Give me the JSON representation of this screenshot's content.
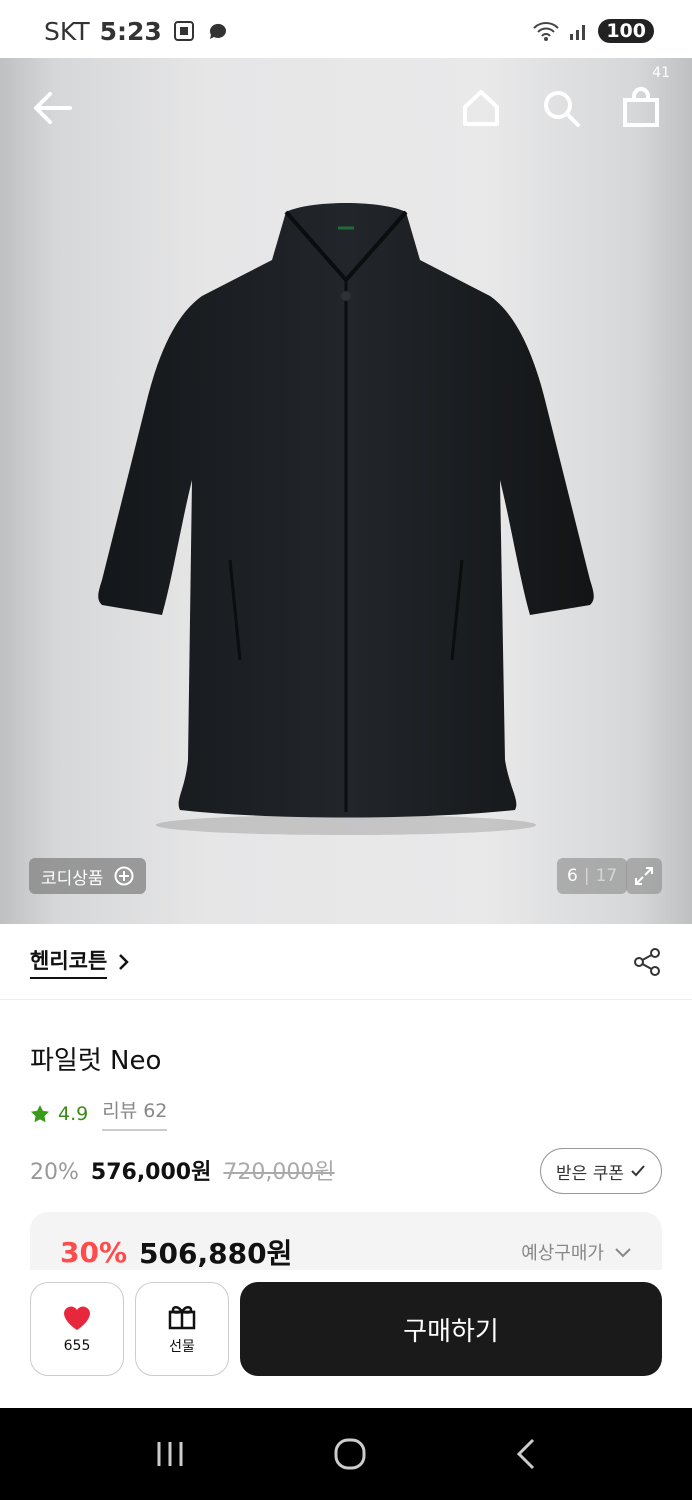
{
  "status_bar": {
    "carrier": "SKT",
    "time": "5:23",
    "battery": "100"
  },
  "header": {
    "cart_count": "41"
  },
  "gallery": {
    "codi_label": "코디상품",
    "current": "6",
    "separator": "|",
    "total": "17"
  },
  "brand": {
    "name": "헨리코튼"
  },
  "product": {
    "title": "파일럿 Neo",
    "rating": "4.9",
    "review_label": "리뷰 62",
    "discount": "20%",
    "price": "576,000원",
    "original_price": "720,000원",
    "coupon_label": "받은 쿠폰"
  },
  "estimate": {
    "discount": "30%",
    "price": "506,880원",
    "label": "예상구매가"
  },
  "actions": {
    "like_count": "655",
    "gift_label": "선물",
    "buy_label": "구매하기"
  },
  "colors": {
    "accent_red": "#ff4b4b",
    "rating_green": "#3a8a1a",
    "buy_button": "#1a1a1a",
    "heart": "#e8263c"
  }
}
